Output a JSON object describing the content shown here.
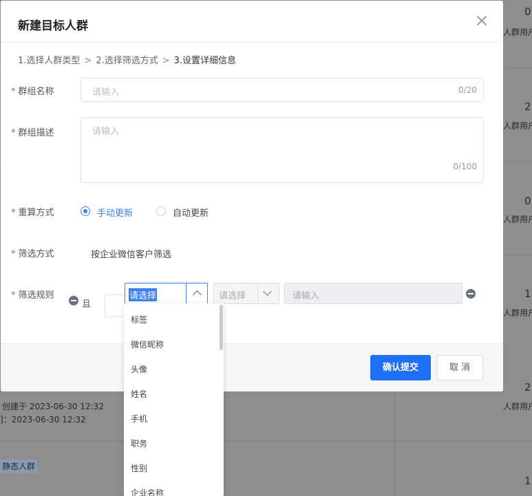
{
  "modal": {
    "title": "新建目标人群",
    "breadcrumb": {
      "step1": "1.选择人群类型",
      "step2": "2.选择筛选方式",
      "step3": "3.设置详细信息",
      "sep": ">"
    }
  },
  "form": {
    "required_mark": "*",
    "group_name": {
      "label": "群组名称",
      "placeholder": "请输入",
      "count": "0/20"
    },
    "group_desc": {
      "label": "群组描述",
      "placeholder": "请输入",
      "count": "0/100"
    },
    "recalc": {
      "label": "重算方式",
      "option_manual": "手动更新",
      "option_auto": "自动更新",
      "selected": "手动更新"
    },
    "filter_method": {
      "label": "筛选方式",
      "value": "按企业微信客户筛选"
    },
    "filter_rule": {
      "label": "筛选规则",
      "and_label": "且",
      "field_select": "请选择",
      "op_select_placeholder": "请选择",
      "value_placeholder": "请输入"
    }
  },
  "dropdown": {
    "options": [
      "标签",
      "微信昵称",
      "头像",
      "姓名",
      "手机",
      "职务",
      "性别",
      "企业名称"
    ]
  },
  "footer": {
    "confirm_label": "确认提交",
    "cancel_label": "取消"
  },
  "background": {
    "counts": [
      "0",
      "2",
      "0",
      "1",
      "2",
      "1"
    ],
    "user_label": "人群用户",
    "created_text": "创建于 2023-06-30 12:32",
    "updated_text": "]：2023-06-30 12:32",
    "tag_text": "静态人群"
  },
  "colors": {
    "primary": "#1f6ff5",
    "required": "#e14b4b",
    "radio_active": "#3a7ff6"
  }
}
